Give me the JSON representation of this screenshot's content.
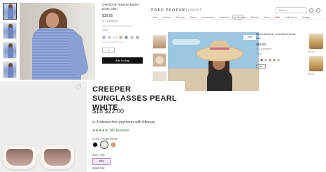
{
  "panel_shirt": {
    "fav_label": "♡",
    "title": "Oversized Textured Button Down Shirt",
    "price": "$39.95",
    "line1": "or 4 payments",
    "line2": "Color",
    "swatch_colors": [
      "#8ba0d2",
      "#d9c9b4",
      "#ffffff",
      "#c9a08a",
      "#6f6f6f",
      "#e8b2b2",
      "#9aa4a8"
    ],
    "qty": "1",
    "add_button": "Add to Bag"
  },
  "panel_hat": {
    "logo": "FREE PEOPLE",
    "sub_logo": "movement",
    "search_placeholder": "Search",
    "nav_items": [
      "New",
      "Clothes",
      "Dresses",
      "Shoes",
      "Accessories",
      "Intimates",
      "Activewear",
      "Beauty",
      "Home",
      "Sale",
      "Collections",
      "Vintage"
    ],
    "hero_tag": "Sale",
    "title": "Bikini Dreamer Oversized Straw Hat",
    "price": "$68.00",
    "line1": "or 4 payments",
    "line2": "Color",
    "color_dots": [
      "#d9b98a",
      "#333333",
      "#e6d3b0",
      "#b98a5c",
      "#a88e72",
      "#f0e2c7"
    ],
    "size": "OS",
    "rec_price_1": "$48.00",
    "rec_price_2": "$58.00"
  },
  "panel_glasses": {
    "heart": "♡"
  },
  "panel_glasses_info": {
    "name": "CREEPER SUNGLASSES PEARL WHITE",
    "price": "$18 $22.00",
    "afterpay": "or 4 interest-free payments with Afterpay",
    "reviews": "★★★★★ 186 Reviews",
    "color_label": "Color: Pearl White",
    "colors": [
      "#111111",
      "#f3efe6",
      "#d9a16a"
    ],
    "size_label": "Size: OS",
    "size_value": "OS",
    "sold_out": "Sold Out"
  }
}
